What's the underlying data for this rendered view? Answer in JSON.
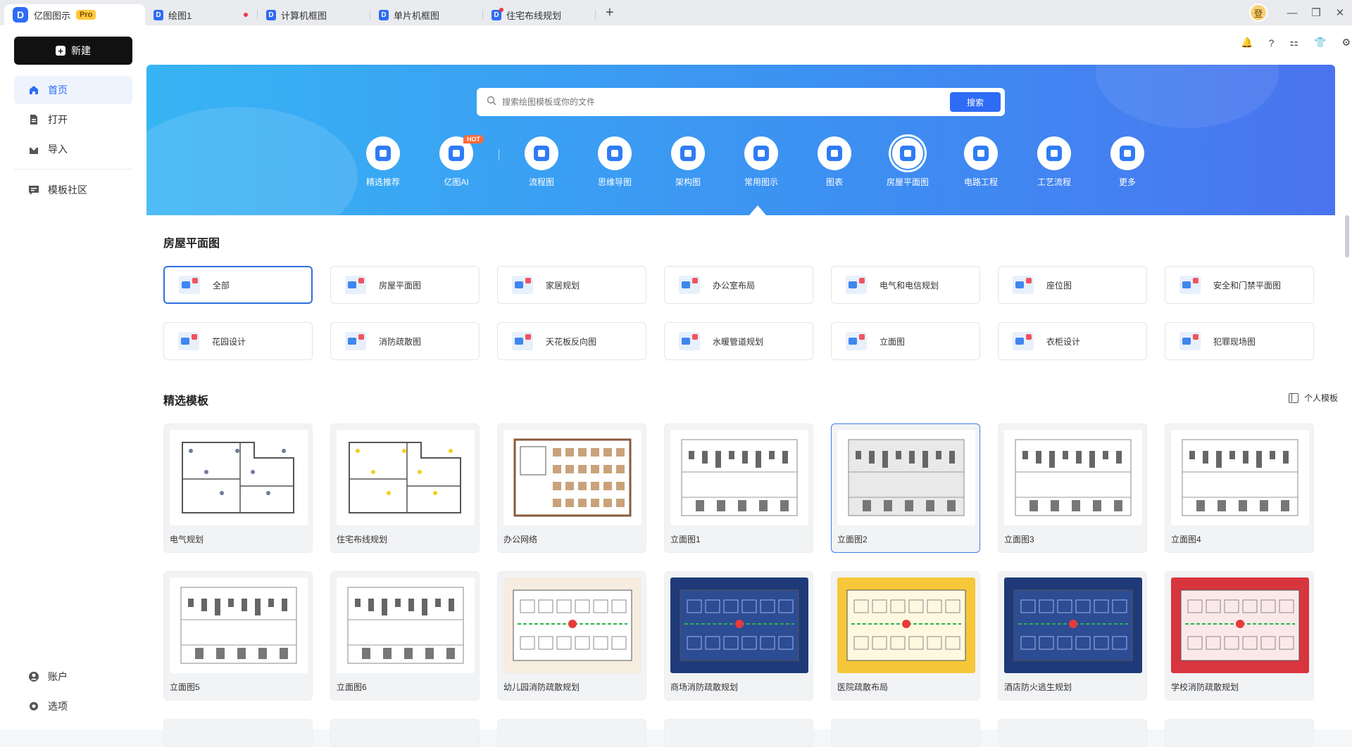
{
  "app": {
    "name": "亿图图示",
    "badge": "Pro",
    "avatar": "登"
  },
  "tabs": [
    {
      "label": "绘图1",
      "unsaved": true,
      "dot": false
    },
    {
      "label": "计算机框图",
      "unsaved": false,
      "dot": false
    },
    {
      "label": "单片机框图",
      "unsaved": false,
      "dot": false
    },
    {
      "label": "住宅布线规划",
      "unsaved": false,
      "dot": true
    }
  ],
  "sidebar": {
    "new_label": "新建",
    "items": [
      {
        "label": "首页",
        "icon": "home-icon"
      },
      {
        "label": "打开",
        "icon": "file-icon"
      },
      {
        "label": "导入",
        "icon": "import-icon"
      },
      {
        "label": "模板社区",
        "icon": "community-icon"
      }
    ],
    "bottom": [
      {
        "label": "账户",
        "icon": "user-icon"
      },
      {
        "label": "选项",
        "icon": "gear-icon"
      }
    ]
  },
  "search": {
    "placeholder": "搜索绘图模板或你的文件",
    "button": "搜索"
  },
  "categories": [
    {
      "label": "精选推荐",
      "hot": ""
    },
    {
      "label": "亿图AI",
      "hot": "HOT"
    },
    {
      "label": "流程图",
      "hot": ""
    },
    {
      "label": "思维导图",
      "hot": ""
    },
    {
      "label": "架构图",
      "hot": ""
    },
    {
      "label": "常用图示",
      "hot": ""
    },
    {
      "label": "图表",
      "hot": ""
    },
    {
      "label": "房屋平面图",
      "hot": ""
    },
    {
      "label": "电路工程",
      "hot": ""
    },
    {
      "label": "工艺流程",
      "hot": ""
    },
    {
      "label": "更多",
      "hot": ""
    }
  ],
  "section_title": "房屋平面图",
  "subcategories": [
    "全部",
    "房屋平面图",
    "家居规划",
    "办公室布局",
    "电气和电信规划",
    "座位图",
    "安全和门禁平面图",
    "花园设计",
    "消防疏散图",
    "天花板反向图",
    "水暖管道规划",
    "立面图",
    "衣柜设计",
    "犯罪现场图"
  ],
  "featured": {
    "title": "精选模板",
    "personal_label": "个人模板",
    "cards": [
      "电气规划",
      "住宅布线规划",
      "办公网络",
      "立面图1",
      "立面图2",
      "立面图3",
      "立面图4",
      "立面图5",
      "立面图6",
      "幼儿园消防疏散规划",
      "商场消防疏散规划",
      "医院疏散布局",
      "酒店防火逃生规划",
      "学校消防疏散规划"
    ]
  },
  "colors": {
    "accent": "#2e6cf6",
    "banner_start": "#37b4f4",
    "banner_end": "#4a74ef"
  }
}
